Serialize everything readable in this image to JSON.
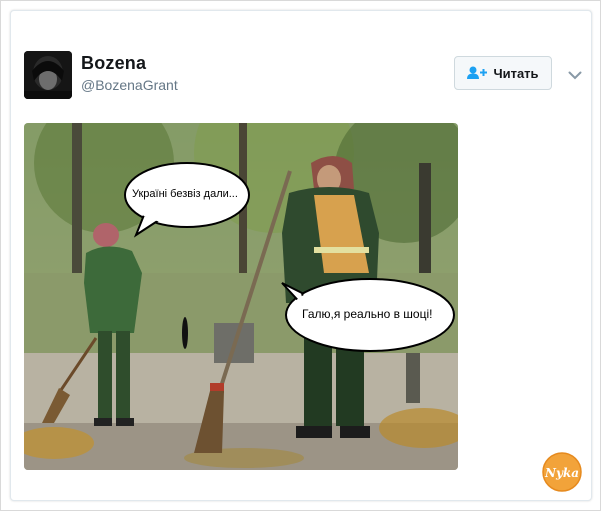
{
  "tweet": {
    "display_name": "Bozena",
    "handle": "@BozenaGrant",
    "follow_label": "Читать",
    "follow_icon": "add-user-icon",
    "menu_icon": "chevron-down-icon"
  },
  "photo": {
    "bubble_left": "Україні безвіз дали...",
    "bubble_right": "Галю,я реально в шоці!"
  },
  "watermark": {
    "text": "Nyka"
  },
  "colors": {
    "accent": "#1da1f2",
    "text": "#14171a",
    "muted": "#657786",
    "button_bg": "#f5f8fa",
    "watermark": "#f2a33a"
  }
}
